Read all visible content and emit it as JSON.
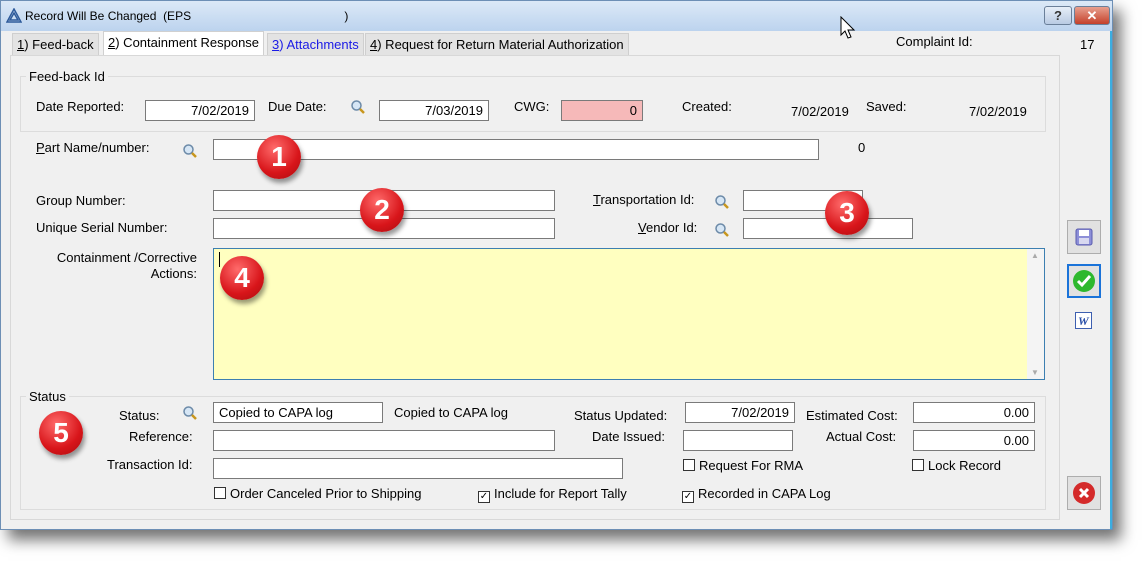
{
  "window": {
    "title": "Record Will Be Changed  (EPS                                              )",
    "help": "?",
    "close": "✕"
  },
  "tabs": [
    {
      "num": "1",
      "label": ") Feed-back"
    },
    {
      "num": "2",
      "label": ") Containment Response"
    },
    {
      "num": "3",
      "label": ") Attachments"
    },
    {
      "num": "4",
      "label": ") Request for Return Material Authorization"
    }
  ],
  "complaint": {
    "label": "Complaint Id:",
    "value": "17"
  },
  "feedback": {
    "group": "Feed-back Id",
    "date_reported_label": "Date Reported:",
    "date_reported": "7/02/2019",
    "due_label": "Due Date:",
    "due": "7/03/2019",
    "cwg_label": "CWG:",
    "cwg": "0",
    "created_label": "Created:",
    "created": "7/02/2019",
    "saved_label": "Saved:",
    "saved": "7/02/2019"
  },
  "part": {
    "label_u": "P",
    "label": "art Name/number:",
    "value": "",
    "count": "0"
  },
  "group_number": {
    "label": "Group Number:",
    "value": ""
  },
  "serial": {
    "label": "Unique Serial Number:",
    "value": ""
  },
  "transport": {
    "label_u": "T",
    "label": "ransportation Id:",
    "value": ""
  },
  "vendor": {
    "label_u": "V",
    "label": "endor Id:",
    "value": ""
  },
  "actions": {
    "label1": "Containment /Corrective",
    "label2": "Actions:",
    "value": ""
  },
  "status": {
    "group": "Status",
    "status_label": "Status:",
    "status_value": "Copied to CAPA log",
    "status_desc": "Copied to CAPA log",
    "reference_label": "Reference:",
    "reference": "",
    "transaction_label": "Transaction Id:",
    "transaction": "",
    "updated_label": "Status Updated:",
    "updated": "7/02/2019",
    "issued_label": "Date Issued:",
    "issued": "",
    "est_label": "Estimated Cost:",
    "est": "0.00",
    "actual_label": "Actual Cost:",
    "actual": "0.00",
    "rma": "Request For RMA",
    "lock": "Lock Record",
    "order_canceled": "Order Canceled Prior to Shipping",
    "include_tally": "Include for Report Tally",
    "recorded_capa": "Recorded in CAPA Log",
    "check": "✓"
  },
  "badges": [
    "1",
    "2",
    "3",
    "4",
    "5"
  ]
}
